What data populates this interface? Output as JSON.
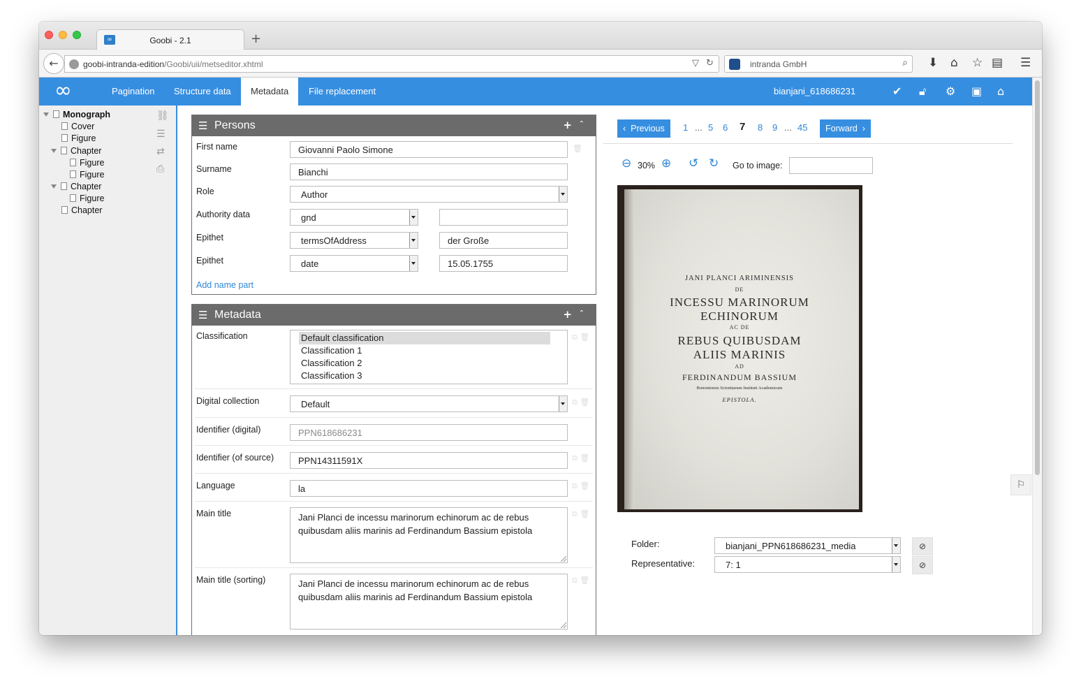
{
  "browser": {
    "tab_title": "Goobi - 2.1",
    "favicon": "∞",
    "url_host": "goobi-intranda-edition",
    "url_path": "/Goobi/uii/metseditor.xhtml",
    "search_text": "intranda GmbH"
  },
  "header": {
    "logo": "∞",
    "tabs": [
      "Pagination",
      "Structure data",
      "Metadata",
      "File replacement"
    ],
    "active_tab": "Metadata",
    "process_id": "bianjani_618686231",
    "accent_color": "#368ee0"
  },
  "tree": {
    "root": "Monograph",
    "nodes": [
      "Cover",
      "Figure",
      "Chapter",
      "Figure",
      "Figure",
      "Chapter",
      "Figure",
      "Chapter"
    ]
  },
  "persons": {
    "title": "Persons",
    "first_name_label": "First name",
    "first_name": "Giovanni Paolo Simone",
    "surname_label": "Surname",
    "surname": "Bianchi",
    "role_label": "Role",
    "role": "Author",
    "authority_label": "Authority data",
    "authority_source": "gnd",
    "authority_value": "",
    "epithet1_label": "Epithet",
    "epithet1_type": "termsOfAddress",
    "epithet1_value": "der Große",
    "epithet2_label": "Epithet",
    "epithet2_type": "date",
    "epithet2_value": "15.05.1755",
    "add_name_part": "Add name part"
  },
  "metadata": {
    "title": "Metadata",
    "classification_label": "Classification",
    "classification_options": [
      "Default classification",
      "Classification 1",
      "Classification 2",
      "Classification 3"
    ],
    "digital_collection_label": "Digital collection",
    "digital_collection": "Default",
    "identifier_digital_label": "Identifier (digital)",
    "identifier_digital": "PPN618686231",
    "identifier_source_label": "Identifier (of source)",
    "identifier_source": "PPN14311591X",
    "language_label": "Language",
    "language": "la",
    "main_title_label": "Main title",
    "main_title": "Jani Planci de incessu marinorum echinorum ac de rebus quibusdam aliis marinis ad Ferdinandum Bassium epistola",
    "main_title_sorting_label": "Main title (sorting)",
    "main_title_sorting": "Jani Planci de incessu marinorum echinorum ac de rebus quibusdam aliis marinis ad Ferdinandum Bassium epistola"
  },
  "viewer": {
    "previous": "Previous",
    "forward": "Forward",
    "pages": [
      "1",
      "...",
      "5",
      "6",
      "7",
      "8",
      "9",
      "...",
      "45"
    ],
    "current_page": "7",
    "zoom": "30%",
    "goto_label": "Go to image:",
    "goto_value": "",
    "scan_lines": [
      "JANI PLANCI ARIMINENSIS",
      "DE",
      "INCESSU MARINORUM",
      "ECHINORUM",
      "AC DE",
      "REBUS QUIBUSDAM",
      "ALIIS MARINIS",
      "AD",
      "FERDINANDUM BASSIUM",
      "Bononiensis Scientiarum Instituti Academicum",
      "EPISTOLA."
    ],
    "folder_label": "Folder:",
    "folder": "bianjani_PPN618686231_media",
    "representative_label": "Representative:",
    "representative": "7: 1"
  }
}
